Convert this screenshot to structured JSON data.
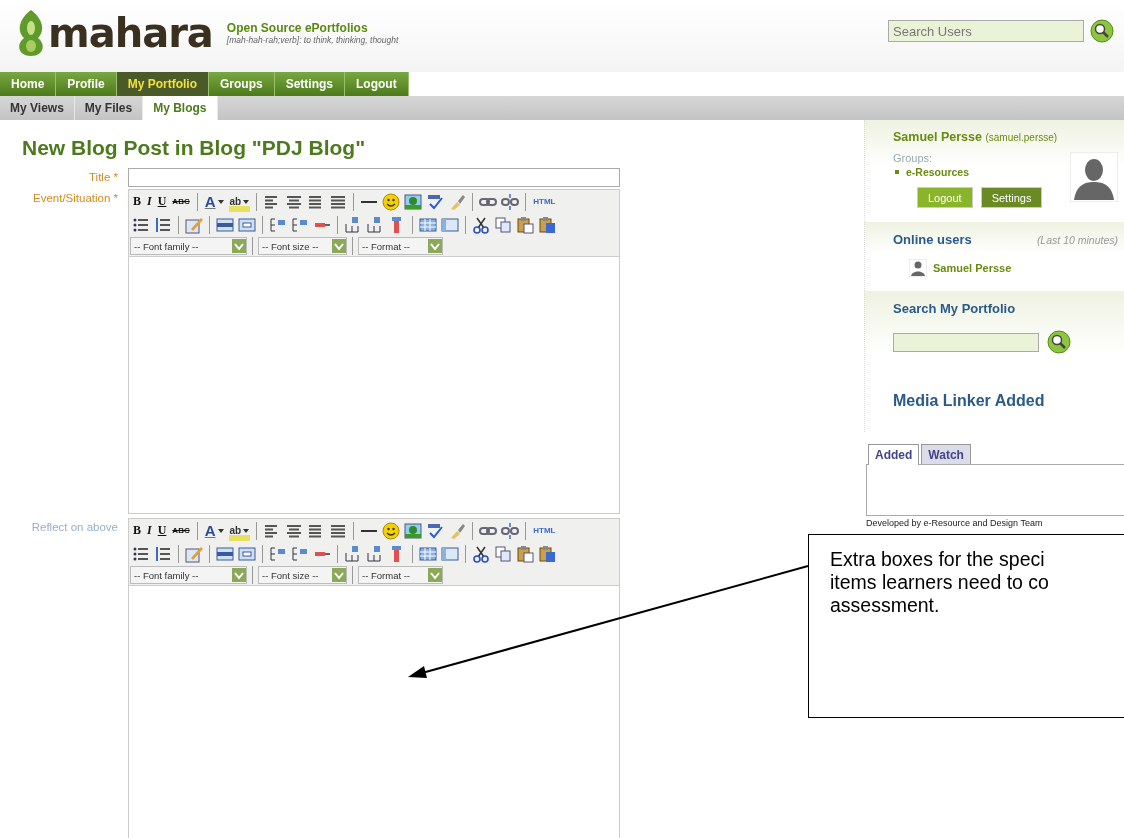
{
  "header": {
    "logo_text": "mahara",
    "tagline": "Open Source ePortfolios",
    "subtitle": "[mah-hah-rah;verb]: to think, thinking, thought",
    "search": {
      "placeholder": "Search Users"
    }
  },
  "nav": [
    {
      "label": "Home",
      "selected": false
    },
    {
      "label": "Profile",
      "selected": false
    },
    {
      "label": "My Portfolio",
      "selected": true
    },
    {
      "label": "Groups",
      "selected": false
    },
    {
      "label": "Settings",
      "selected": false
    },
    {
      "label": "Logout",
      "selected": false
    }
  ],
  "subnav": [
    {
      "label": "My Views",
      "selected": false
    },
    {
      "label": "My Files",
      "selected": false
    },
    {
      "label": "My Blogs",
      "selected": true
    }
  ],
  "page_title": "New Blog Post in Blog \"PDJ Blog\"",
  "fields": [
    {
      "kind": "text",
      "label": "Title *",
      "required": true
    },
    {
      "kind": "editor",
      "label": "Event/Situation *",
      "required": true,
      "toolbar": {
        "text_buttons": [
          "B",
          "I",
          "U",
          "ABC",
          "A",
          "ab",
          "HTML"
        ],
        "selects": [
          "-- Font family --",
          "-- Font size --",
          "-- Format --"
        ]
      }
    },
    {
      "kind": "editor",
      "label": "Reflect on above",
      "required": false,
      "toolbar": {
        "text_buttons": [
          "B",
          "I",
          "U",
          "ABC",
          "A",
          "ab",
          "HTML"
        ],
        "selects": [
          "-- Font family --",
          "-- Font size --",
          "-- Format --"
        ]
      }
    }
  ],
  "sidebar": {
    "profile": {
      "name": "Samuel Persse",
      "username": "(samuel.persse)",
      "groups_label": "Groups:",
      "groups": [
        "e-Resources"
      ],
      "buttons": [
        {
          "label": "Logout",
          "kind": "light"
        },
        {
          "label": "Settings",
          "kind": "dark"
        }
      ]
    },
    "online": {
      "title": "Online users",
      "note": "(Last 10 minutes)",
      "users": [
        "Samuel Persse"
      ]
    },
    "search_portfolio": {
      "title": "Search My Portfolio"
    },
    "media_linker": {
      "title": "Media Linker Added",
      "tabs": [
        {
          "label": "Added",
          "selected": true
        },
        {
          "label": "Watch",
          "selected": false
        }
      ],
      "footer": "Developed by e-Resource and Design Team"
    }
  },
  "annotation": {
    "lines": [
      "Extra boxes for the speci",
      "items learners need to co",
      "assessment."
    ]
  }
}
